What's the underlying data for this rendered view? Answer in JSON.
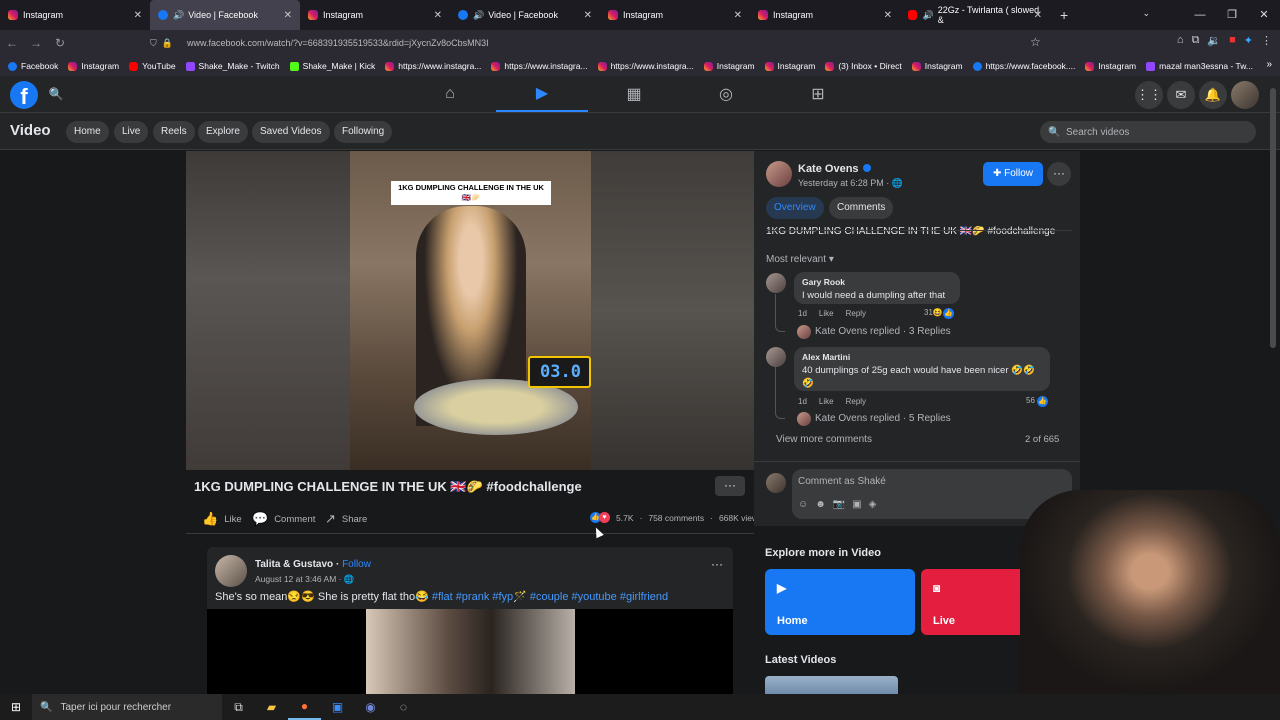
{
  "browser": {
    "tabs": [
      {
        "title": "Instagram",
        "favicon": "instagram-icon",
        "active": false
      },
      {
        "title": "Video | Facebook",
        "favicon": "facebook-icon",
        "active": true,
        "audio": true
      },
      {
        "title": "Instagram",
        "favicon": "instagram-icon",
        "active": false
      },
      {
        "title": "Video | Facebook",
        "favicon": "facebook-icon",
        "active": false,
        "audio": true
      },
      {
        "title": "Instagram",
        "favicon": "instagram-icon",
        "active": false
      },
      {
        "title": "Instagram",
        "favicon": "instagram-icon",
        "active": false
      },
      {
        "title": "22Gz - Twirlanta ( slowed &",
        "favicon": "youtube-icon",
        "active": false,
        "audio": true
      }
    ],
    "url": "www.facebook.com/watch/?v=668391935519533&rdid=jXycnZv8oCbsMN3I",
    "bookmarks": [
      "Facebook",
      "Instagram",
      "YouTube",
      "Shake_Make - Twitch",
      "Shake_Make | Kick",
      "https://www.instagra...",
      "https://www.instagra...",
      "https://www.instagra...",
      "Instagram",
      "Instagram",
      "(3) Inbox • Direct",
      "Instagram",
      "https://www.facebook....",
      "Instagram",
      "mazal man3essna - Tw..."
    ]
  },
  "fb": {
    "section_title": "Video",
    "nav_pills": [
      "Home",
      "Live",
      "Reels",
      "Explore",
      "Saved Videos",
      "Following"
    ],
    "search_placeholder": "Search videos"
  },
  "video": {
    "overlay_label": "1KG DUMPLING CHALLENGE IN THE UK 🇬🇧🥟",
    "timer": "03.0",
    "title": "1KG DUMPLING CHALLENGE IN THE UK 🇬🇧🌮 #foodchallenge",
    "actions": {
      "like": "Like",
      "comment": "Comment",
      "share": "Share"
    },
    "reactions": "5.7K",
    "comments": "758 comments",
    "views": "668K views"
  },
  "panel": {
    "author": "Kate Ovens",
    "time": "Yesterday at 6:28 PM · ",
    "follow": "Follow",
    "tabs": [
      "Overview",
      "Comments"
    ],
    "description_text": "1KG DUMPLING CHALLENGE IN THE UK 🇬🇧🌮 ",
    "description_tag": "#foodchallenge",
    "sort": "Most relevant",
    "comments": [
      {
        "author": "Gary Rook",
        "text": "I would need a dumpling after that",
        "age": "1d",
        "like": "Like",
        "reply": "Reply",
        "count": "31",
        "replied": "Kate Ovens replied · 3 Replies"
      },
      {
        "author": "Alex Martini",
        "text": "40 dumplings of 25g each would have been nicer 🤣🤣🤣",
        "age": "1d",
        "like": "Like",
        "reply": "Reply",
        "count": "56",
        "replied": "Kate Ovens replied · 5 Replies"
      }
    ],
    "view_more": "View more comments",
    "pagination": "2 of 665",
    "comment_placeholder": "Comment as Shaké"
  },
  "post": {
    "author": "Talita & Gustavo",
    "follow": "Follow",
    "time": "August 12 at 3:46 AM · ",
    "text": "She's so mean😒😎 She is pretty flat tho😂 ",
    "tags": "#flat #prank #fyp🪄 #couple #youtube #girlfriend"
  },
  "explore": {
    "title": "Explore more in Video",
    "cards": [
      {
        "label": "Home",
        "color": "#1877f2"
      },
      {
        "label": "Live",
        "color": "#e41e3f"
      }
    ],
    "latest": "Latest Videos"
  },
  "taskbar": {
    "search_placeholder": "Taper ici pour rechercher"
  }
}
